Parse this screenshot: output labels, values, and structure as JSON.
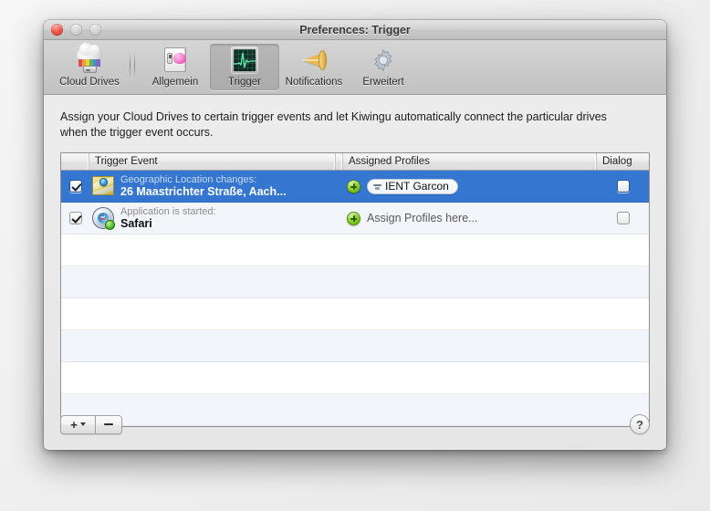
{
  "window": {
    "title": "Preferences: Trigger",
    "controls": {
      "close": "close-button",
      "minimize": "minimize-button",
      "zoom": "zoom-button"
    }
  },
  "toolbar": {
    "items": [
      {
        "label": "Cloud Drives",
        "icon": "cloud-drives-icon",
        "selected": false
      },
      {
        "label": "Allgemein",
        "icon": "general-icon",
        "selected": false
      },
      {
        "label": "Trigger",
        "icon": "trigger-icon",
        "selected": true
      },
      {
        "label": "Notifications",
        "icon": "notifications-icon",
        "selected": false
      },
      {
        "label": "Erweitert",
        "icon": "advanced-icon",
        "selected": false
      }
    ]
  },
  "content": {
    "intro": "Assign your Cloud Drives to certain trigger events and let Kiwingu automatically connect the particular drives when the trigger event occurs."
  },
  "table": {
    "headers": {
      "checkbox": "",
      "event": "Trigger Event",
      "profiles": "Assigned Profiles",
      "dialog": "Dialog"
    },
    "rows": [
      {
        "enabled": true,
        "selected": true,
        "icon": "map-location-icon",
        "subtitle": "Geographic Location changes:",
        "title": "26 Maastrichter Straße, Aach...",
        "add_label": "add-profile-button",
        "profiles": [
          {
            "name": "IENT Garcon",
            "icon": "disk-drive-icon"
          }
        ],
        "profiles_placeholder": "",
        "dialog_checked": false
      },
      {
        "enabled": true,
        "selected": false,
        "icon": "safari-app-icon",
        "subtitle": "Application is started:",
        "title": "Safari",
        "add_label": "add-profile-button",
        "profiles": [],
        "profiles_placeholder": "Assign Profiles here...",
        "dialog_checked": false
      }
    ],
    "empty_row_count": 6
  },
  "bottom": {
    "add_label": "+",
    "remove_label": "−",
    "help_label": "?"
  },
  "colors": {
    "selection_blue": "#3576d0",
    "stripe": "#f2f5f9",
    "window_bg": "#ececec",
    "titlebar": "#c8c8c8",
    "accent_green": "#8fd12f"
  }
}
